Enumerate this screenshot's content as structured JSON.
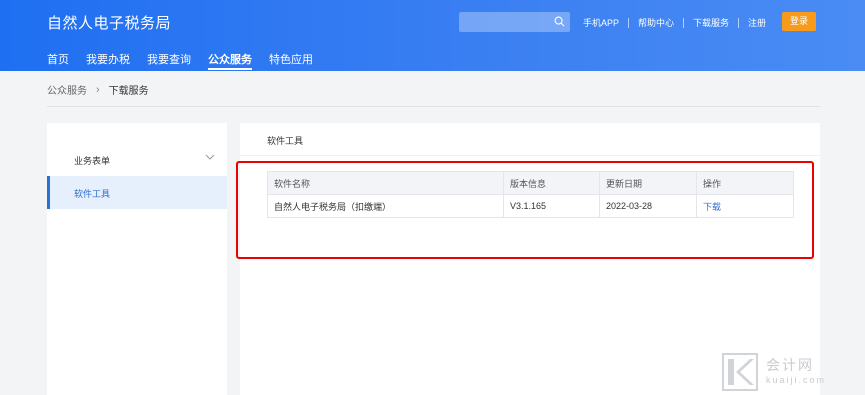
{
  "header": {
    "brand": "自然人电子税务局",
    "search": {
      "placeholder": ""
    },
    "links": [
      "手机APP",
      "帮助中心",
      "下载服务",
      "注册"
    ],
    "login_label": "登录",
    "accent_color": "#1f6ff2",
    "login_color": "#f89b1c"
  },
  "nav": {
    "items": [
      "首页",
      "我要办税",
      "我要查询",
      "公众服务",
      "特色应用"
    ],
    "active": "公众服务"
  },
  "breadcrumb": {
    "parent": "公众服务",
    "current": "下载服务"
  },
  "sidebar": {
    "group_label": "业务表单",
    "active_item": "软件工具"
  },
  "main": {
    "title": "软件工具",
    "table": {
      "headers": [
        "软件名称",
        "版本信息",
        "更新日期",
        "操作"
      ],
      "rows": [
        {
          "name": "自然人电子税务局（扣缴端）",
          "version": "V3.1.165",
          "date": "2022-03-28",
          "action": "下载"
        }
      ]
    }
  },
  "watermark": {
    "cn": "会计网",
    "en": "kuaiji.com"
  }
}
